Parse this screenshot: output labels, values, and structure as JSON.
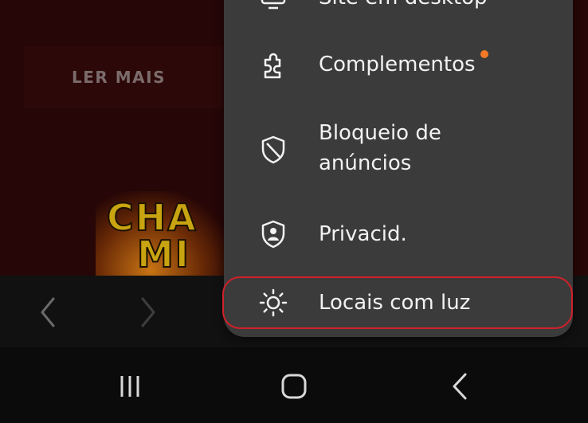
{
  "web": {
    "read_more_label": "LER MAIS",
    "banner_line1": "CHA",
    "banner_line2": "MI"
  },
  "menu": {
    "items": [
      {
        "label": "Site em desktop",
        "icon": "desktop-icon"
      },
      {
        "label": "Complementos",
        "icon": "puzzle-icon",
        "has_notification": true
      },
      {
        "label": "Bloqueio de anúncios",
        "line1": "Bloqueio de",
        "line2": "anúncios",
        "icon": "shield-block-icon"
      },
      {
        "label": "Privacid.",
        "icon": "privacy-shield-icon"
      },
      {
        "label": "Locais com luz",
        "icon": "sun-icon",
        "highlighted": true
      }
    ]
  },
  "browser_toolbar": {
    "back_icon": "chevron-left-icon",
    "forward_icon": "chevron-right-icon"
  },
  "system_nav": {
    "recents_icon": "recents-icon",
    "home_icon": "home-icon",
    "back_icon": "back-icon"
  },
  "colors": {
    "menu_bg": "#3b3b3b",
    "notification_dot": "#f47a25",
    "highlight_outline": "#d1202a",
    "page_bg": "#260606"
  }
}
